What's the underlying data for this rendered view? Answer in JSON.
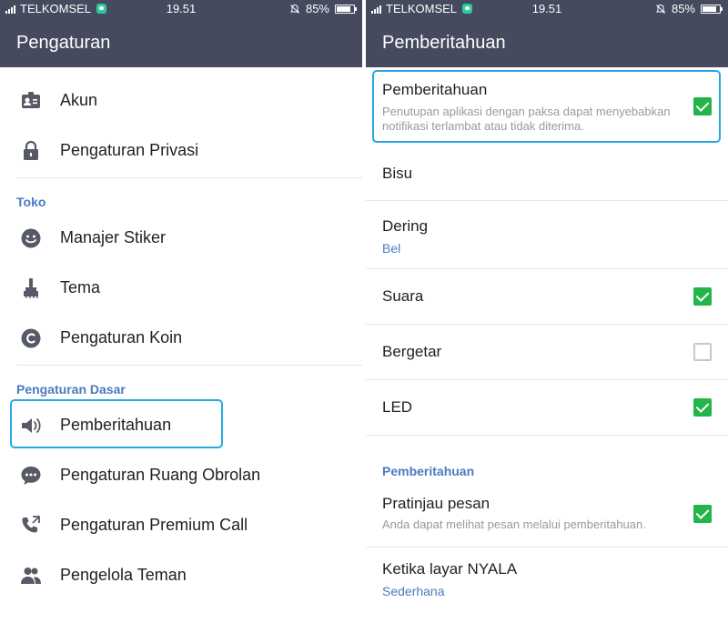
{
  "status_bar": {
    "carrier": "TELKOMSEL",
    "time": "19.51",
    "battery": "85%",
    "battery_level": 0.85
  },
  "left_screen": {
    "title": "Pengaturan",
    "items_top": [
      {
        "label": "Akun",
        "icon": "account-card-icon"
      },
      {
        "label": "Pengaturan Privasi",
        "icon": "lock-icon"
      }
    ],
    "section_shop": "Toko",
    "items_shop": [
      {
        "label": "Manajer Stiker",
        "icon": "smiley-icon"
      },
      {
        "label": "Tema",
        "icon": "paint-brush-icon"
      },
      {
        "label": "Pengaturan Koin",
        "icon": "coin-icon"
      }
    ],
    "section_basic": "Pengaturan Dasar",
    "items_basic": [
      {
        "label": "Pemberitahuan",
        "icon": "speaker-icon"
      },
      {
        "label": "Pengaturan Ruang Obrolan",
        "icon": "chat-bubble-icon"
      },
      {
        "label": "Pengaturan Premium Call",
        "icon": "phone-call-icon"
      },
      {
        "label": "Pengelola Teman",
        "icon": "friends-icon"
      }
    ]
  },
  "right_screen": {
    "title": "Pemberitahuan",
    "notif": {
      "title": "Pemberitahuan",
      "desc": "Penutupan aplikasi dengan paksa dapat menyebabkan notifikasi terlambat atau tidak diterima.",
      "checked": true
    },
    "mute": {
      "title": "Bisu"
    },
    "ring": {
      "title": "Dering",
      "value": "Bel"
    },
    "sound": {
      "title": "Suara",
      "checked": true
    },
    "vibrate": {
      "title": "Bergetar",
      "checked": false
    },
    "led": {
      "title": "LED",
      "checked": true
    },
    "section": "Pemberitahuan",
    "preview": {
      "title": "Pratinjau pesan",
      "desc": "Anda dapat melihat pesan melalui pemberitahuan.",
      "checked": true
    },
    "screen_on": {
      "title": "Ketika layar NYALA",
      "value": "Sederhana"
    }
  },
  "colors": {
    "header": "#454a5e",
    "accent": "#4a7bbf",
    "highlight": "#26a9e0",
    "check": "#22b548"
  }
}
